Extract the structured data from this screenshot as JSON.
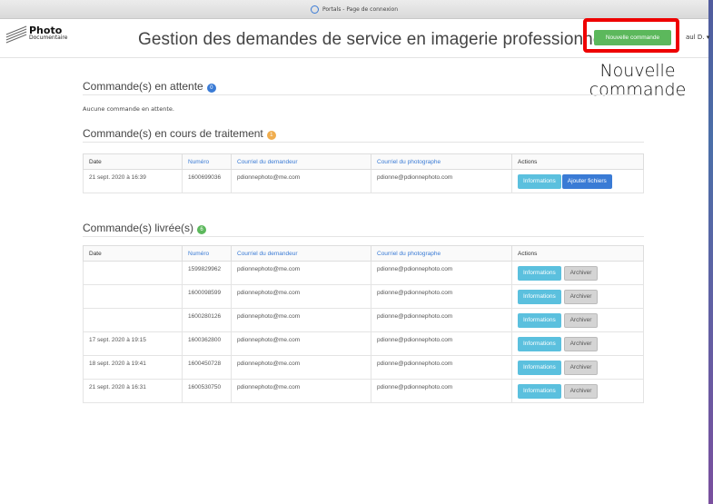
{
  "browser": {
    "tab_title": "Portals - Page de connexion"
  },
  "header": {
    "logo_line1": "Photo",
    "logo_line2": "Documentaire",
    "title": "Gestion des demandes de service en imagerie professionnelle",
    "new_order_button": "Nouvelle commande",
    "user_label": "aul D. ▾"
  },
  "annotation": {
    "line1": "Nouvelle",
    "line2": "commande",
    "highlight_color": "#e00000"
  },
  "pending": {
    "title": "Commande(s) en attente",
    "count": "0",
    "empty_text": "Aucune commande en attente."
  },
  "processing": {
    "title": "Commande(s) en cours de traitement",
    "count": "1",
    "columns": [
      "Date",
      "Numéro",
      "Courriel du demandeur",
      "Courriel du photographe",
      "Actions"
    ],
    "rows": [
      {
        "date": "21 sept. 2020 à 16:39",
        "number": "1600699036",
        "requester": "pdionnephoto@me.com",
        "photographer": "pdionne@pdionnephoto.com",
        "info_label": "Informations",
        "add_label": "Ajouter fichiers"
      }
    ]
  },
  "delivered": {
    "title": "Commande(s) livrée(s)",
    "count": "6",
    "columns": [
      "Date",
      "Numéro",
      "Courriel du demandeur",
      "Courriel du photographe",
      "Actions"
    ],
    "rows": [
      {
        "date": "",
        "number": "1599829962",
        "requester": "pdionnephoto@me.com",
        "photographer": "pdionne@pdionnephoto.com",
        "info_label": "Informations",
        "archive_label": "Archiver"
      },
      {
        "date": "",
        "number": "1600098599",
        "requester": "pdionnephoto@me.com",
        "photographer": "pdionne@pdionnephoto.com",
        "info_label": "Informations",
        "archive_label": "Archiver"
      },
      {
        "date": "",
        "number": "1600280126",
        "requester": "pdionnephoto@me.com",
        "photographer": "pdionne@pdionnephoto.com",
        "info_label": "Informations",
        "archive_label": "Archiver"
      },
      {
        "date": "17 sept. 2020 à 19:15",
        "number": "1600362800",
        "requester": "pdionnephoto@me.com",
        "photographer": "pdionne@pdionnephoto.com",
        "info_label": "Informations",
        "archive_label": "Archiver"
      },
      {
        "date": "18 sept. 2020 à 19:41",
        "number": "1600450728",
        "requester": "pdionnephoto@me.com",
        "photographer": "pdionne@pdionnephoto.com",
        "info_label": "Informations",
        "archive_label": "Archiver"
      },
      {
        "date": "21 sept. 2020 à 16:31",
        "number": "1600530750",
        "requester": "pdionnephoto@me.com",
        "photographer": "pdionne@pdionnephoto.com",
        "info_label": "Informations",
        "archive_label": "Archiver"
      }
    ]
  },
  "colors": {
    "badge_pending": "#3a7bd5",
    "badge_processing": "#f0ad4e",
    "badge_delivered": "#5cb85c",
    "primary_green": "#5cb85c"
  }
}
